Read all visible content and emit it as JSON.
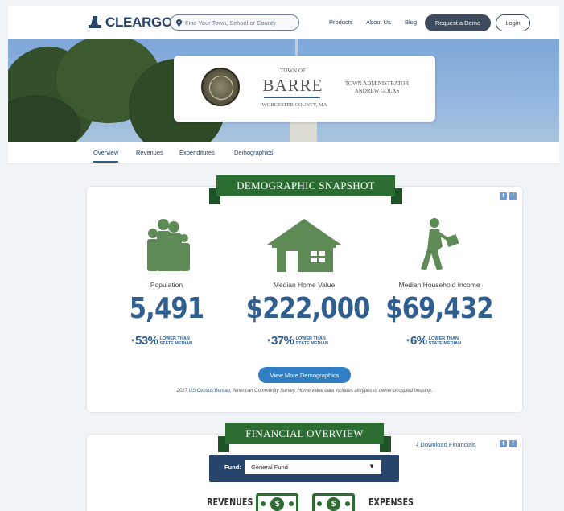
{
  "brand": {
    "name": "CLEARGOV"
  },
  "search": {
    "placeholder": "Find Your Town, School or County"
  },
  "nav": {
    "products": "Products",
    "about": "About Us",
    "blog": "Blog",
    "demo": "Request a Demo",
    "login": "Login"
  },
  "town": {
    "prefix": "TOWN OF",
    "name": "BARRE",
    "county": "WORCESTER COUNTY, MA",
    "admin_title": "TOWN ADMINISTRATOR",
    "admin_name": "ANDREW GOLAS"
  },
  "tabs": [
    "Overview",
    "Revenues",
    "Expenditures",
    "Demographics"
  ],
  "demographics": {
    "title": "DEMOGRAPHIC SNAPSHOT",
    "stats": [
      {
        "label": "Population",
        "value": "5,491",
        "pct": "53%",
        "cmp_line1": "LOWER THAN",
        "cmp_line2": "STATE MEDIAN"
      },
      {
        "label": "Median Home Value",
        "value": "$222,000",
        "pct": "37%",
        "cmp_line1": "LOWER THAN",
        "cmp_line2": "STATE MEDIAN"
      },
      {
        "label": "Median Household Income",
        "value": "$69,432",
        "pct": "6%",
        "cmp_line1": "LOWER THAN",
        "cmp_line2": "STATE MEDIAN"
      }
    ],
    "button": "View More Demographics",
    "source_prefix": "2017 ",
    "source_link": "US Census Bureau",
    "source_suffix": ", American Community Survey. Home value data includes all types of owner-occupied housing."
  },
  "financial": {
    "title": "FINANCIAL OVERVIEW",
    "download": "Download Financials",
    "fund_label": "Fund:",
    "fund_value": "General Fund",
    "revenues": "REVENUES",
    "expenses": "EXPENSES"
  },
  "colors": {
    "navy": "#27446b",
    "green": "#2c6e32",
    "blue": "#2f5e8f",
    "button_blue": "#2f7dc2"
  },
  "icons": {
    "family": "family-icon",
    "house": "house-icon",
    "worker": "briefcase-walker-icon",
    "twitter": "twitter-icon",
    "facebook": "facebook-icon",
    "download": "download-icon",
    "dollar": "dollar-bill-icon"
  }
}
